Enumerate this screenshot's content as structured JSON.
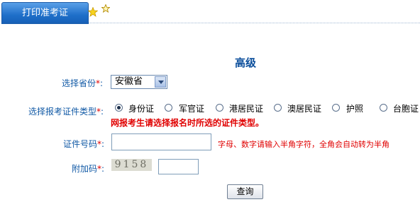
{
  "tab": {
    "label": "打印准考证"
  },
  "form": {
    "title": "高级",
    "province": {
      "label": "选择省份",
      "required_mark": "*",
      "value": "安徽省"
    },
    "id_type": {
      "label": "选择报考证件类型",
      "required_mark": "*",
      "options": [
        "身份证",
        "军官证",
        "港居民证",
        "澳居民证",
        "护照",
        "台胞证"
      ],
      "selected": "身份证",
      "warning": "网报考生请选择报名时所选的证件类型。"
    },
    "id_number": {
      "label": "证件号码",
      "required_mark": "*",
      "value": "",
      "hint": "字母、数字请输入半角字符，全角会自动转为半角"
    },
    "captcha": {
      "label": "附加码",
      "required_mark": "*",
      "image_text": "9158",
      "value": ""
    },
    "submit_label": "查询"
  },
  "colors": {
    "tab_blue": "#1f6fc9",
    "label_blue": "#125aa6",
    "required_red": "#e00000",
    "title_blue": "#0c4f9c"
  },
  "icons": [
    "star-icon",
    "star-outline-icon",
    "chevron-down-icon"
  ]
}
